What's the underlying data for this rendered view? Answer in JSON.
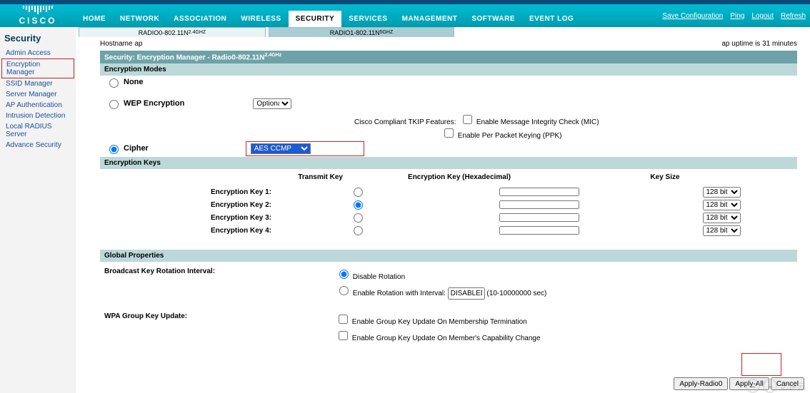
{
  "top_right": {
    "save": "Save Configuration",
    "ping": "Ping",
    "logout": "Logout",
    "refresh": "Refresh"
  },
  "logo_text": "CISCO",
  "main_nav": {
    "home": "HOME",
    "network": "NETWORK",
    "association": "ASSOCIATION",
    "wireless": "WIRELESS",
    "security": "SECURITY",
    "services": "SERVICES",
    "management": "MANAGEMENT",
    "software": "SOFTWARE",
    "eventlog": "EVENT LOG"
  },
  "side_title": "Security",
  "side_links": {
    "admin": "Admin Access",
    "enc": "Encryption Manager",
    "ssid": "SSID Manager",
    "server": "Server Manager",
    "apauth": "AP Authentication",
    "intr": "Intrusion Detection",
    "radius": "Local RADIUS Server",
    "adv": "Advance Security"
  },
  "tabs": {
    "t1_a": "RADIO0-802.11N",
    "t1_b": "2.4GHZ",
    "t2_a": "RADIO1-802.11N",
    "t2_b": "5GHZ"
  },
  "host": {
    "label": "Hostname  ap",
    "uptime": "ap uptime is 31 minutes"
  },
  "sec_title_a": "Security: Encryption Manager - Radio0-802.11N",
  "sec_title_b": "2.4GHz",
  "enc_modes_title": "Encryption Modes",
  "opt_none": "None",
  "opt_wep": "WEP Encryption",
  "wep_sel": "Optional",
  "tkip_label": "Cisco Compliant TKIP Features:",
  "tkip_mic": "Enable Message Integrity Check (MIC)",
  "tkip_ppk": "Enable Per Packet Keying (PPK)",
  "opt_cipher": "Cipher",
  "cipher_sel": "AES CCMP",
  "keys_title": "Encryption Keys",
  "keys_head": {
    "c1": "Transmit Key",
    "c2": "Encryption Key (Hexadecimal)",
    "c3": "Key Size"
  },
  "keys": {
    "k1": "Encryption Key 1:",
    "k2": "Encryption Key 2:",
    "k3": "Encryption Key 3:",
    "k4": "Encryption Key 4:",
    "size": "128 bit"
  },
  "global_title": "Global Properties",
  "gp": {
    "broadcast_lab": "Broadcast Key Rotation Interval:",
    "disable": "Disable Rotation",
    "enable_a": "Enable Rotation with Interval:",
    "enable_val": "DISABLED",
    "enable_b": "(10-10000000 sec)",
    "wpa_lab": "WPA Group Key Update:",
    "wpa1": "Enable Group Key Update On Membership Termination",
    "wpa2": "Enable Group Key Update On Member's Capability Change"
  },
  "buttons": {
    "applyR": "Apply-Radio0",
    "applyA": "Apply-All",
    "cancel": "Cancel"
  },
  "watermark": "亿速云"
}
